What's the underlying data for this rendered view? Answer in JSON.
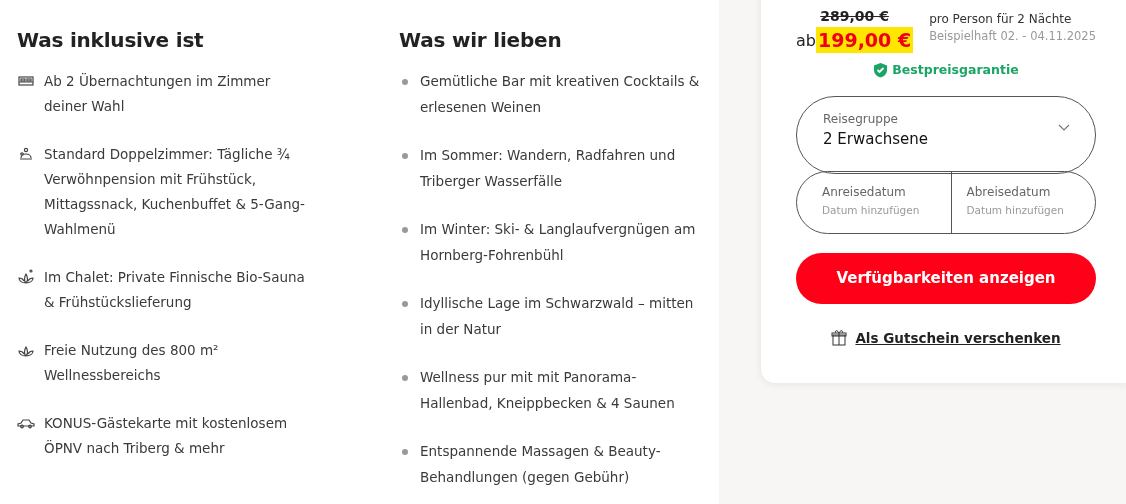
{
  "included": {
    "title": "Was inklusive ist",
    "items": [
      {
        "text": "Ab 2 Übernachtungen im Zimmer deiner Wahl"
      },
      {
        "text": "Standard Doppelzimmer: Tägliche ¾ Verwöhnpension mit Frühstück, Mittagssnack, Kuchenbuffet & 5-Gang-Wahlmenü"
      },
      {
        "text": "Im Chalet: Private Finnische Bio-Sauna & Frühstückslieferung"
      },
      {
        "text": "Freie Nutzung des 800 m² Wellnessbereichs"
      },
      {
        "text": "KONUS-Gästekarte mit kostenlosem ÖPNV nach Triberg & mehr"
      }
    ]
  },
  "loved": {
    "title": "Was wir lieben",
    "items": [
      "Gemütliche Bar mit kreativen Cocktails & erlesenen Weinen",
      "Im Sommer: Wandern, Radfahren und Triberger Wasserfälle",
      "Im Winter: Ski- & Langlaufvergnügen am Hornberg-Fohrenbühl",
      "Idyllische Lage im Schwarzwald – mitten in der Natur",
      "Wellness pur mit mit Panorama-Hallenbad, Kneippbecken & 4 Saunen",
      "Entspannende Massagen & Beauty-Behandlungen (gegen Gebühr)"
    ]
  },
  "booking": {
    "old_price": "289,00 €",
    "prefix": "ab",
    "price": "199,00 €",
    "per": "pro Person für 2 Nächte",
    "example": "Beispielhaft 02. - 04.11.2025",
    "guarantee": "Bestpreisgarantie",
    "group": {
      "label": "Reisegruppe",
      "value": "2 Erwachsene"
    },
    "dates": [
      {
        "label": "Anreisedatum",
        "placeholder": "Datum hinzufügen"
      },
      {
        "label": "Abreisedatum",
        "placeholder": "Datum hinzufügen"
      }
    ],
    "button": "Verfügbarkeiten anzeigen",
    "voucher": "Als Gutschein verschenken"
  }
}
